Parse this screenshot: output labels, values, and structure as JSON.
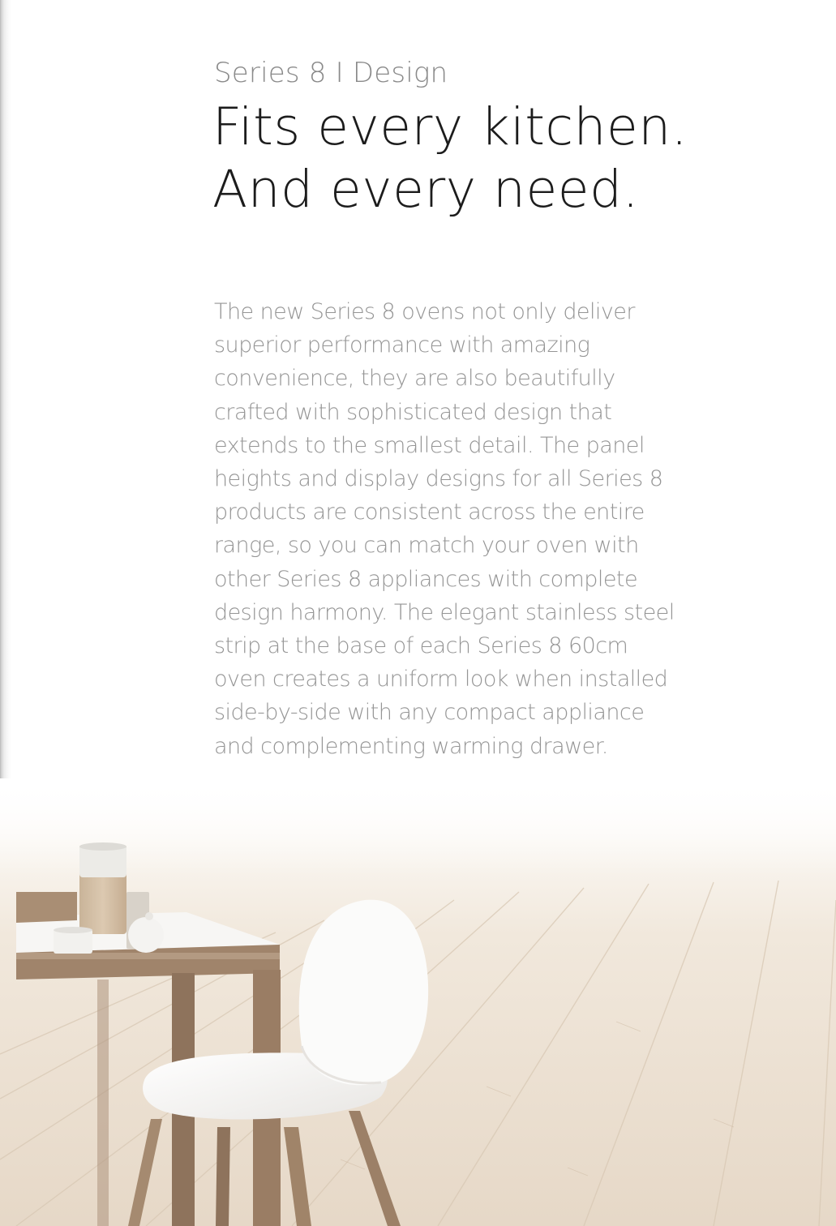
{
  "kicker": "Series 8 I Design",
  "headline": {
    "line1": "Fits every kitchen.",
    "line2": "And every need."
  },
  "body": {
    "lines": [
      "The new Series 8 ovens not only deliver",
      "superior performance with amazing",
      "convenience, they are also beautifully",
      "crafted with sophisticated design that",
      "extends to the smallest detail. The panel",
      "heights and display designs for all Series 8",
      "products are consistent across the entire",
      "range, so you can match your oven with",
      "other Series 8 appliances with complete",
      "design harmony. The elegant stainless steel",
      "strip at the base of each Series 8 60cm",
      "oven creates a uniform look when installed",
      "side-by-side with any compact appliance",
      "and  complementing warming drawer."
    ]
  },
  "colors": {
    "headline": "#1c1c1c",
    "kicker": "#8a8a8a",
    "body": "#959595",
    "floor": "#efe5d8",
    "table_wood": "#9a7d64"
  }
}
